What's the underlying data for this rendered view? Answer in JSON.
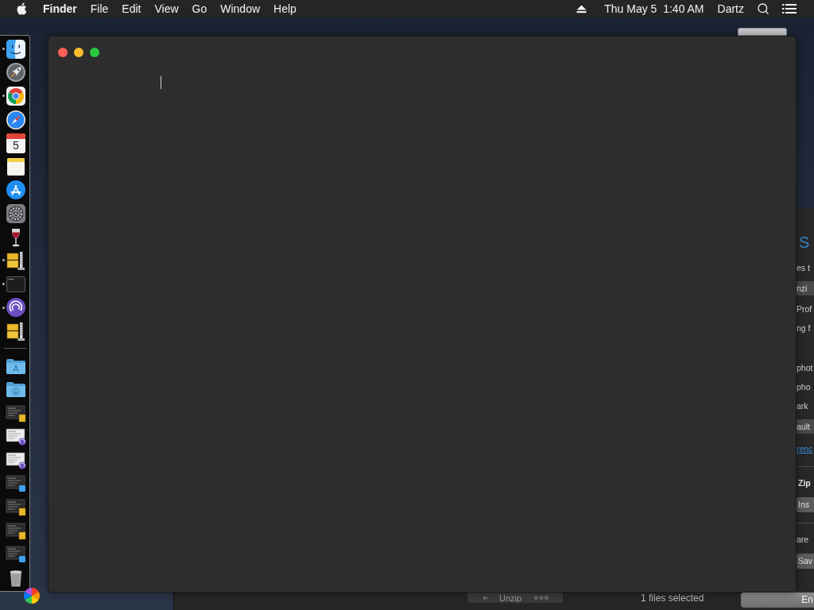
{
  "menu_bar": {
    "app_name": "Finder",
    "menus": [
      "File",
      "Edit",
      "View",
      "Go",
      "Window",
      "Help"
    ],
    "clock": "Thu May 5  1:40 AM",
    "user": "Dartz"
  },
  "dock": {
    "apps": [
      {
        "kind": "face",
        "running": true
      },
      {
        "kind": "rocket",
        "running": false
      },
      {
        "kind": "browser",
        "running": true
      },
      {
        "kind": "compass",
        "running": false
      },
      {
        "kind": "calendar",
        "running": false,
        "day": "5"
      },
      {
        "kind": "notepad",
        "running": false
      },
      {
        "kind": "store",
        "running": false
      },
      {
        "kind": "gear",
        "running": false
      },
      {
        "kind": "glass",
        "running": false
      },
      {
        "kind": "archive",
        "running": true
      },
      {
        "kind": "terminal",
        "running": true
      },
      {
        "kind": "swirl",
        "running": true
      },
      {
        "kind": "archive",
        "running": false
      }
    ],
    "folders": [
      {
        "kind": "applications"
      },
      {
        "kind": "downloads"
      }
    ],
    "windows": [
      {
        "kind": "dark",
        "badge": {
          "kind": "archive"
        }
      },
      {
        "kind": "light",
        "badge": {
          "kind": "swirl"
        }
      },
      {
        "kind": "light",
        "badge": {
          "kind": "swirl"
        }
      },
      {
        "kind": "dark",
        "badge": {
          "kind": "face"
        }
      },
      {
        "kind": "dark",
        "badge": {
          "kind": "archive"
        }
      },
      {
        "kind": "dark",
        "badge": {
          "kind": "archive"
        }
      },
      {
        "kind": "dark",
        "badge": {
          "kind": "face"
        }
      }
    ]
  },
  "editor": {
    "focused": true
  },
  "side_window": {
    "sections": [
      {
        "rule": false,
        "items": [
          {
            "kind": "heading",
            "text": "S"
          },
          {
            "kind": "label",
            "text": "es t"
          },
          {
            "kind": "field",
            "text": "nzi"
          },
          {
            "kind": "label",
            "text": "Prof"
          },
          {
            "kind": "label",
            "text": "ng f"
          }
        ]
      },
      {
        "rule": false,
        "items": [
          {
            "kind": "label",
            "text": "phot"
          },
          {
            "kind": "label",
            "text": "pho"
          },
          {
            "kind": "label",
            "text": "ark"
          },
          {
            "kind": "field",
            "text": "ault"
          },
          {
            "kind": "link",
            "text": "renc"
          }
        ]
      },
      {
        "rule": true,
        "items": [
          {
            "kind": "section_title",
            "text": "Zip"
          },
          {
            "kind": "button",
            "text": "Ins"
          }
        ]
      },
      {
        "rule": true,
        "items": [
          {
            "kind": "label",
            "text": "are"
          },
          {
            "kind": "button",
            "text": "Sav"
          }
        ]
      }
    ]
  },
  "bottom_window": {
    "toolbar_button": "Unzip",
    "status": "1 files selected",
    "button": "En"
  }
}
